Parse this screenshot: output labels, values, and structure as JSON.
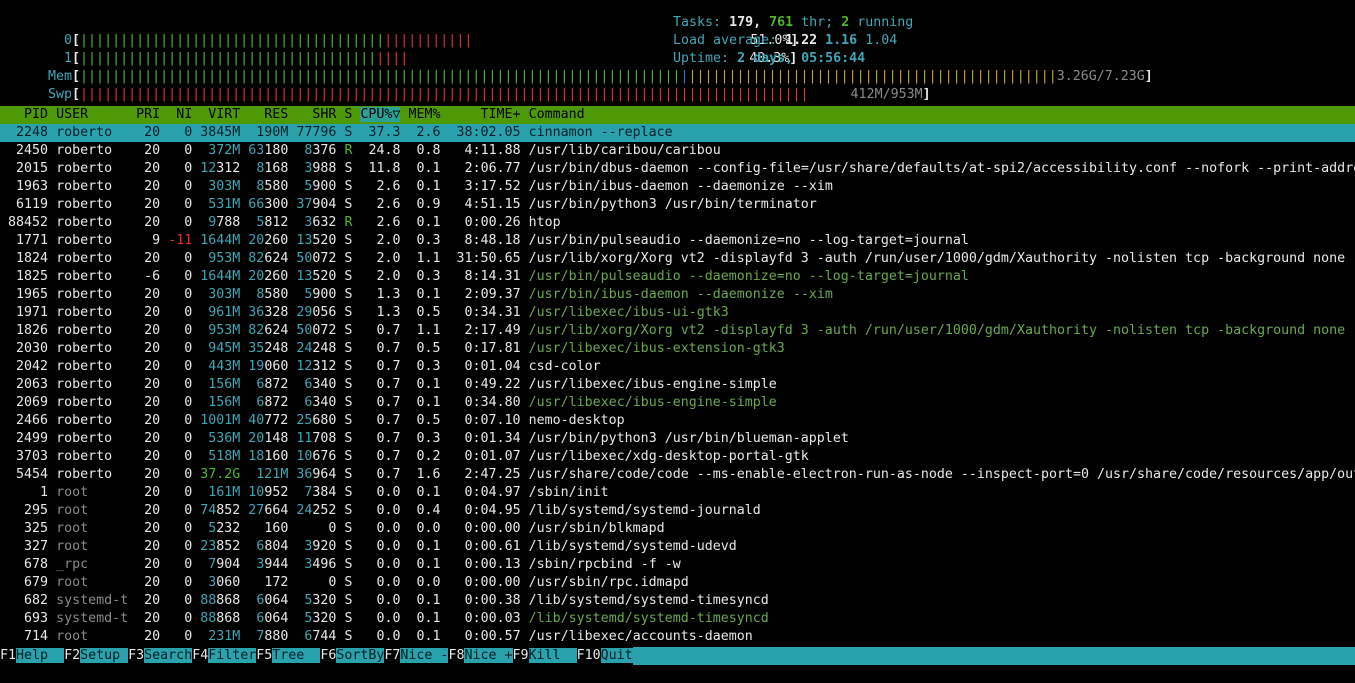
{
  "meters": {
    "cpu0": {
      "label": "0",
      "percent": "51.0%"
    },
    "cpu1": {
      "label": "1",
      "percent": "40.3%"
    },
    "mem": {
      "label": "Mem",
      "value": "3.26G/7.23G"
    },
    "swp": {
      "label": "Swp",
      "value": "412M/953M"
    }
  },
  "stats": {
    "tasks_label": "Tasks:",
    "tasks": "179,",
    "threads": "761",
    "thr_label": "thr;",
    "running": "2",
    "running_label": "running",
    "load_label": "Load average:",
    "load1": "1.22",
    "load5": "1.16",
    "load15": "1.04",
    "uptime_label": "Uptime:",
    "uptime": "2 days, 05:56:44"
  },
  "columns": {
    "pid": "PID",
    "user": "USER",
    "pri": "PRI",
    "ni": "NI",
    "virt": "VIRT",
    "res": "RES",
    "shr": "SHR",
    "s": "S",
    "cpu": "CPU%▽",
    "mem": "MEM%",
    "time": "TIME+",
    "command": "Command"
  },
  "processes": [
    {
      "pid": "2248",
      "user": "roberto",
      "pri": "20",
      "ni": "0",
      "virt": "3845M",
      "res": "190M",
      "shr": "77796",
      "s": "S",
      "cpu": "37.3",
      "mem": "2.6",
      "time": "38:02.05",
      "cmd": "cinnamon --replace",
      "sel": true
    },
    {
      "pid": "2450",
      "user": "roberto",
      "pri": "20",
      "ni": "0",
      "virt": "372M",
      "res": "63180",
      "shr": "8376",
      "s": "R",
      "cpu": "24.8",
      "mem": "0.8",
      "time": "4:11.88",
      "cmd": "/usr/lib/caribou/caribou"
    },
    {
      "pid": "2015",
      "user": "roberto",
      "pri": "20",
      "ni": "0",
      "virt": "12312",
      "res": "8168",
      "shr": "3988",
      "s": "S",
      "cpu": "11.8",
      "mem": "0.1",
      "time": "2:06.77",
      "cmd": "/usr/bin/dbus-daemon --config-file=/usr/share/defaults/at-spi2/accessibility.conf --nofork --print-addre"
    },
    {
      "pid": "1963",
      "user": "roberto",
      "pri": "20",
      "ni": "0",
      "virt": "303M",
      "res": "8580",
      "shr": "5900",
      "s": "S",
      "cpu": "2.6",
      "mem": "0.1",
      "time": "3:17.52",
      "cmd": "/usr/bin/ibus-daemon --daemonize --xim"
    },
    {
      "pid": "6119",
      "user": "roberto",
      "pri": "20",
      "ni": "0",
      "virt": "531M",
      "res": "66300",
      "shr": "37904",
      "s": "S",
      "cpu": "2.6",
      "mem": "0.9",
      "time": "4:51.15",
      "cmd": "/usr/bin/python3 /usr/bin/terminator"
    },
    {
      "pid": "88452",
      "user": "roberto",
      "pri": "20",
      "ni": "0",
      "virt": "9788",
      "res": "5812",
      "shr": "3632",
      "s": "R",
      "cpu": "2.6",
      "mem": "0.1",
      "time": "0:00.26",
      "cmd": "htop"
    },
    {
      "pid": "1771",
      "user": "roberto",
      "pri": "9",
      "ni": "-11",
      "virt": "1644M",
      "res": "20260",
      "shr": "13520",
      "s": "S",
      "cpu": "2.0",
      "mem": "0.3",
      "time": "8:48.18",
      "cmd": "/usr/bin/pulseaudio --daemonize=no --log-target=journal"
    },
    {
      "pid": "1824",
      "user": "roberto",
      "pri": "20",
      "ni": "0",
      "virt": "953M",
      "res": "82624",
      "shr": "50072",
      "s": "S",
      "cpu": "2.0",
      "mem": "1.1",
      "time": "31:50.65",
      "cmd": "/usr/lib/xorg/Xorg vt2 -displayfd 3 -auth /run/user/1000/gdm/Xauthority -nolisten tcp -background none -"
    },
    {
      "pid": "1825",
      "user": "roberto",
      "pri": "-6",
      "ni": "0",
      "virt": "1644M",
      "res": "20260",
      "shr": "13520",
      "s": "S",
      "cpu": "2.0",
      "mem": "0.3",
      "time": "8:14.31",
      "cmd": "/usr/bin/pulseaudio --daemonize=no --log-target=journal",
      "thread": true
    },
    {
      "pid": "1965",
      "user": "roberto",
      "pri": "20",
      "ni": "0",
      "virt": "303M",
      "res": "8580",
      "shr": "5900",
      "s": "S",
      "cpu": "1.3",
      "mem": "0.1",
      "time": "2:09.37",
      "cmd": "/usr/bin/ibus-daemon --daemonize --xim",
      "thread": true
    },
    {
      "pid": "1971",
      "user": "roberto",
      "pri": "20",
      "ni": "0",
      "virt": "961M",
      "res": "36328",
      "shr": "29056",
      "s": "S",
      "cpu": "1.3",
      "mem": "0.5",
      "time": "0:34.31",
      "cmd": "/usr/libexec/ibus-ui-gtk3",
      "thread": true
    },
    {
      "pid": "1826",
      "user": "roberto",
      "pri": "20",
      "ni": "0",
      "virt": "953M",
      "res": "82624",
      "shr": "50072",
      "s": "S",
      "cpu": "0.7",
      "mem": "1.1",
      "time": "2:17.49",
      "cmd": "/usr/lib/xorg/Xorg vt2 -displayfd 3 -auth /run/user/1000/gdm/Xauthority -nolisten tcp -background none -",
      "thread": true
    },
    {
      "pid": "2030",
      "user": "roberto",
      "pri": "20",
      "ni": "0",
      "virt": "945M",
      "res": "35248",
      "shr": "24248",
      "s": "S",
      "cpu": "0.7",
      "mem": "0.5",
      "time": "0:17.81",
      "cmd": "/usr/libexec/ibus-extension-gtk3",
      "thread": true
    },
    {
      "pid": "2042",
      "user": "roberto",
      "pri": "20",
      "ni": "0",
      "virt": "443M",
      "res": "19060",
      "shr": "12312",
      "s": "S",
      "cpu": "0.7",
      "mem": "0.3",
      "time": "0:01.04",
      "cmd": "csd-color"
    },
    {
      "pid": "2063",
      "user": "roberto",
      "pri": "20",
      "ni": "0",
      "virt": "156M",
      "res": "6872",
      "shr": "6340",
      "s": "S",
      "cpu": "0.7",
      "mem": "0.1",
      "time": "0:49.22",
      "cmd": "/usr/libexec/ibus-engine-simple"
    },
    {
      "pid": "2069",
      "user": "roberto",
      "pri": "20",
      "ni": "0",
      "virt": "156M",
      "res": "6872",
      "shr": "6340",
      "s": "S",
      "cpu": "0.7",
      "mem": "0.1",
      "time": "0:34.80",
      "cmd": "/usr/libexec/ibus-engine-simple",
      "thread": true
    },
    {
      "pid": "2466",
      "user": "roberto",
      "pri": "20",
      "ni": "0",
      "virt": "1001M",
      "res": "40772",
      "shr": "25680",
      "s": "S",
      "cpu": "0.7",
      "mem": "0.5",
      "time": "0:07.10",
      "cmd": "nemo-desktop"
    },
    {
      "pid": "2499",
      "user": "roberto",
      "pri": "20",
      "ni": "0",
      "virt": "536M",
      "res": "20148",
      "shr": "11708",
      "s": "S",
      "cpu": "0.7",
      "mem": "0.3",
      "time": "0:01.34",
      "cmd": "/usr/bin/python3 /usr/bin/blueman-applet"
    },
    {
      "pid": "3703",
      "user": "roberto",
      "pri": "20",
      "ni": "0",
      "virt": "518M",
      "res": "18160",
      "shr": "10676",
      "s": "S",
      "cpu": "0.7",
      "mem": "0.2",
      "time": "0:01.07",
      "cmd": "/usr/libexec/xdg-desktop-portal-gtk"
    },
    {
      "pid": "5454",
      "user": "roberto",
      "pri": "20",
      "ni": "0",
      "virt": "37.2G",
      "res": "121M",
      "shr": "36964",
      "s": "S",
      "cpu": "0.7",
      "mem": "1.6",
      "time": "2:47.25",
      "cmd": "/usr/share/code/code --ms-enable-electron-run-as-node --inspect-port=0 /usr/share/code/resources/app/out"
    },
    {
      "pid": "1",
      "user": "root",
      "pri": "20",
      "ni": "0",
      "virt": "161M",
      "res": "10952",
      "shr": "7384",
      "s": "S",
      "cpu": "0.0",
      "mem": "0.1",
      "time": "0:04.97",
      "cmd": "/sbin/init"
    },
    {
      "pid": "295",
      "user": "root",
      "pri": "20",
      "ni": "0",
      "virt": "74852",
      "res": "27664",
      "shr": "24252",
      "s": "S",
      "cpu": "0.0",
      "mem": "0.4",
      "time": "0:04.95",
      "cmd": "/lib/systemd/systemd-journald"
    },
    {
      "pid": "325",
      "user": "root",
      "pri": "20",
      "ni": "0",
      "virt": "5232",
      "res": "160",
      "shr": "0",
      "s": "S",
      "cpu": "0.0",
      "mem": "0.0",
      "time": "0:00.00",
      "cmd": "/usr/sbin/blkmapd"
    },
    {
      "pid": "327",
      "user": "root",
      "pri": "20",
      "ni": "0",
      "virt": "23852",
      "res": "6804",
      "shr": "3920",
      "s": "S",
      "cpu": "0.0",
      "mem": "0.1",
      "time": "0:00.61",
      "cmd": "/lib/systemd/systemd-udevd"
    },
    {
      "pid": "678",
      "user": "_rpc",
      "pri": "20",
      "ni": "0",
      "virt": "7904",
      "res": "3944",
      "shr": "3496",
      "s": "S",
      "cpu": "0.0",
      "mem": "0.1",
      "time": "0:00.13",
      "cmd": "/sbin/rpcbind -f -w"
    },
    {
      "pid": "679",
      "user": "root",
      "pri": "20",
      "ni": "0",
      "virt": "3060",
      "res": "172",
      "shr": "0",
      "s": "S",
      "cpu": "0.0",
      "mem": "0.0",
      "time": "0:00.00",
      "cmd": "/usr/sbin/rpc.idmapd"
    },
    {
      "pid": "682",
      "user": "systemd-t",
      "pri": "20",
      "ni": "0",
      "virt": "88868",
      "res": "6064",
      "shr": "5320",
      "s": "S",
      "cpu": "0.0",
      "mem": "0.1",
      "time": "0:00.38",
      "cmd": "/lib/systemd/systemd-timesyncd"
    },
    {
      "pid": "693",
      "user": "systemd-t",
      "pri": "20",
      "ni": "0",
      "virt": "88868",
      "res": "6064",
      "shr": "5320",
      "s": "S",
      "cpu": "0.0",
      "mem": "0.1",
      "time": "0:00.03",
      "cmd": "/lib/systemd/systemd-timesyncd",
      "thread": true
    },
    {
      "pid": "714",
      "user": "root",
      "pri": "20",
      "ni": "0",
      "virt": "231M",
      "res": "7880",
      "shr": "6744",
      "s": "S",
      "cpu": "0.0",
      "mem": "0.1",
      "time": "0:00.57",
      "cmd": "/usr/libexec/accounts-daemon"
    }
  ],
  "footer": [
    {
      "key": "F1",
      "label": "Help  "
    },
    {
      "key": "F2",
      "label": "Setup "
    },
    {
      "key": "F3",
      "label": "Search"
    },
    {
      "key": "F4",
      "label": "Filter"
    },
    {
      "key": "F5",
      "label": "Tree  "
    },
    {
      "key": "F6",
      "label": "SortBy"
    },
    {
      "key": "F7",
      "label": "Nice -"
    },
    {
      "key": "F8",
      "label": "Nice +"
    },
    {
      "key": "F9",
      "label": "Kill  "
    },
    {
      "key": "F10",
      "label": "Quit"
    }
  ],
  "colors": {
    "header_bg": "#4e9a06",
    "selected_bg": "#2aa2ad",
    "accent_cyan": "#3fa7b5",
    "green": "#4db82b",
    "red": "#e03030"
  }
}
